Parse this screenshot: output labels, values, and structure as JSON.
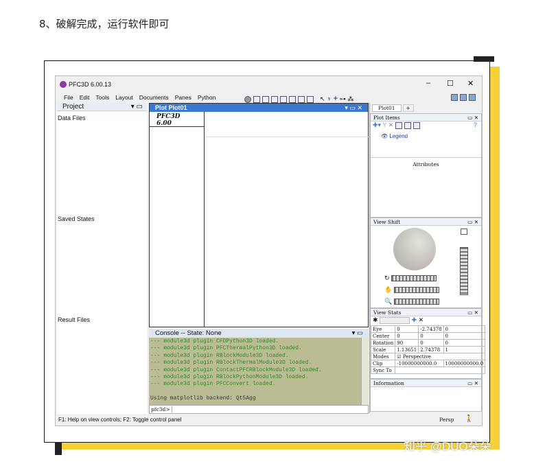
{
  "caption": "8、破解完成，运行软件即可",
  "watermark": "知乎 @DUO朵朵",
  "window": {
    "title": "PFC3D 6.00.13",
    "minimize": "–",
    "maximize": "☐",
    "close": "✕"
  },
  "menu": [
    "File",
    "Edit",
    "Tools",
    "Layout",
    "Documents",
    "Panes",
    "Python"
  ],
  "project": {
    "title": "Project",
    "sections": [
      "Data Files",
      "Saved States",
      "Result Files"
    ]
  },
  "plot": {
    "title": "Plot Plot01",
    "legend_title": "PFC3D 6.00"
  },
  "console": {
    "title": "Console -- State: None",
    "lines": [
      "--- module3d plugin CFDPython3D loaded.",
      "--- module3d plugin PFCThermalPython3D loaded.",
      "--- module3d plugin RBlockModule3D loaded.",
      "--- module3d plugin RBlockThermalModule3D loaded.",
      "--- module3d plugin ContactPFCRBlockModule3D loaded.",
      "--- module3d plugin RBlockPythonModule3D loaded.",
      "--- module3d plugin PFCConvert loaded."
    ],
    "backend": "Using matplotlib backend: Qt5Agg",
    "prompt": "pfc3d>",
    "input": ""
  },
  "status": {
    "help": "F1: Help on view controls; F2: Toggle control panel",
    "mode": "Persp"
  },
  "right": {
    "tabs": [
      "Plot01",
      "+"
    ],
    "plot_items": "Plot Items",
    "legend": "Legend",
    "attributes": "Attributes",
    "view_shift": "View Shift",
    "view_stats": "View Stats",
    "information": "Information",
    "stats": [
      [
        "Eye",
        "0",
        "-2.74378",
        "0"
      ],
      [
        "Center",
        "0",
        "0",
        "0"
      ],
      [
        "Rotation",
        "90",
        "0",
        "0"
      ],
      [
        "Scale",
        "1.13651",
        "2.74378",
        "1"
      ]
    ],
    "modes_label": "Modes",
    "perspective": "Perspective",
    "clip_label": "Clip",
    "clip_min": "-10000000000.0",
    "clip_max": "10000000000.0",
    "sync_label": "Sync To",
    "help": "?"
  },
  "colors": {
    "accent": "#3b78d0",
    "console_bg": "#bcbc94",
    "console_text": "#2e8a20",
    "shadow": "#f3d23a"
  }
}
